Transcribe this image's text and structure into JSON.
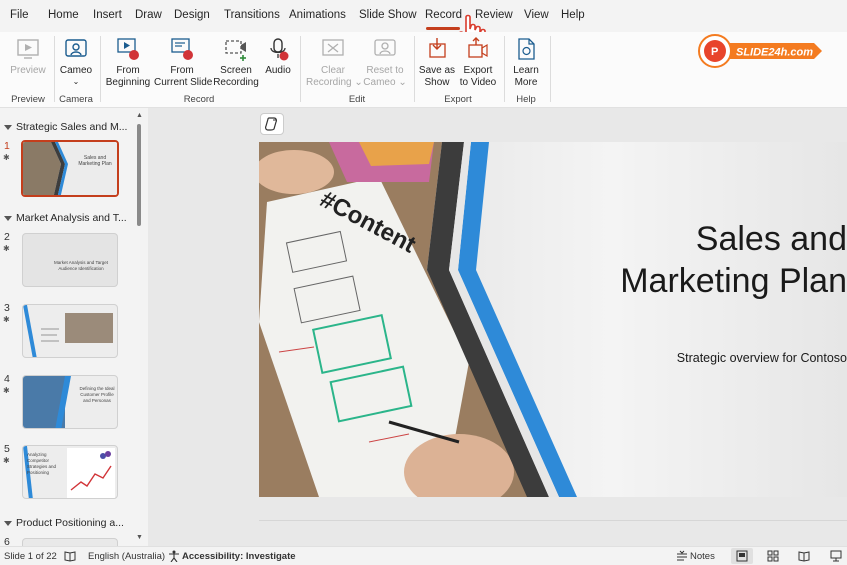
{
  "menu": {
    "items": [
      "File",
      "Home",
      "Insert",
      "Draw",
      "Design",
      "Transitions",
      "Animations",
      "Slide Show",
      "Record",
      "Review",
      "View",
      "Help"
    ],
    "active": "Record"
  },
  "ribbon": {
    "preview": {
      "label": "Preview",
      "group": "Preview"
    },
    "camera": {
      "label": "Cameo",
      "group": "Camera"
    },
    "record": {
      "from_beginning": [
        "From",
        "Beginning"
      ],
      "from_current": [
        "From",
        "Current Slide"
      ],
      "screen_recording": [
        "Screen",
        "Recording"
      ],
      "audio": "Audio",
      "group": "Record"
    },
    "edit": {
      "clear_recording": [
        "Clear",
        "Recording"
      ],
      "reset_to_cameo": [
        "Reset to",
        "Cameo"
      ],
      "group": "Edit"
    },
    "export": {
      "save_as_show": [
        "Save as",
        "Show"
      ],
      "export_to_video": [
        "Export",
        "to Video"
      ],
      "group": "Export"
    },
    "help": {
      "learn_more": [
        "Learn",
        "More"
      ],
      "group": "Help"
    }
  },
  "logo": {
    "text": "SLIDE24h.com"
  },
  "sections": [
    {
      "title": "Strategic Sales and M..."
    },
    {
      "title": "Market Analysis and T..."
    },
    {
      "title": "Product Positioning a..."
    }
  ],
  "slides": [
    {
      "number": "1",
      "text": "Sales and Marketing Plan",
      "sub": "Strategic overview for Contoso",
      "active": true
    },
    {
      "number": "2",
      "text": "Market Analysis and Target Audience Identification"
    },
    {
      "number": "3",
      "text": ""
    },
    {
      "number": "4",
      "text": "Defining the Ideal Customer Profile and Personas"
    },
    {
      "number": "5",
      "text": "Analyzing Competitor Strategies and Positioning"
    },
    {
      "number": "6",
      "text": ""
    }
  ],
  "main_slide": {
    "title_line1": "Sales and",
    "title_line2": "Marketing Plan",
    "subtitle": "Strategic overview for Contoso",
    "image_text": "#Content"
  },
  "status": {
    "slide_counter": "Slide 1 of 22",
    "language": "English (Australia)",
    "accessibility": "Accessibility: Investigate",
    "notes": "Notes"
  },
  "colors": {
    "accent": "#c43e1c",
    "blue_stripe": "#2e8ad8",
    "dark_stripe": "#3c3c3c"
  }
}
